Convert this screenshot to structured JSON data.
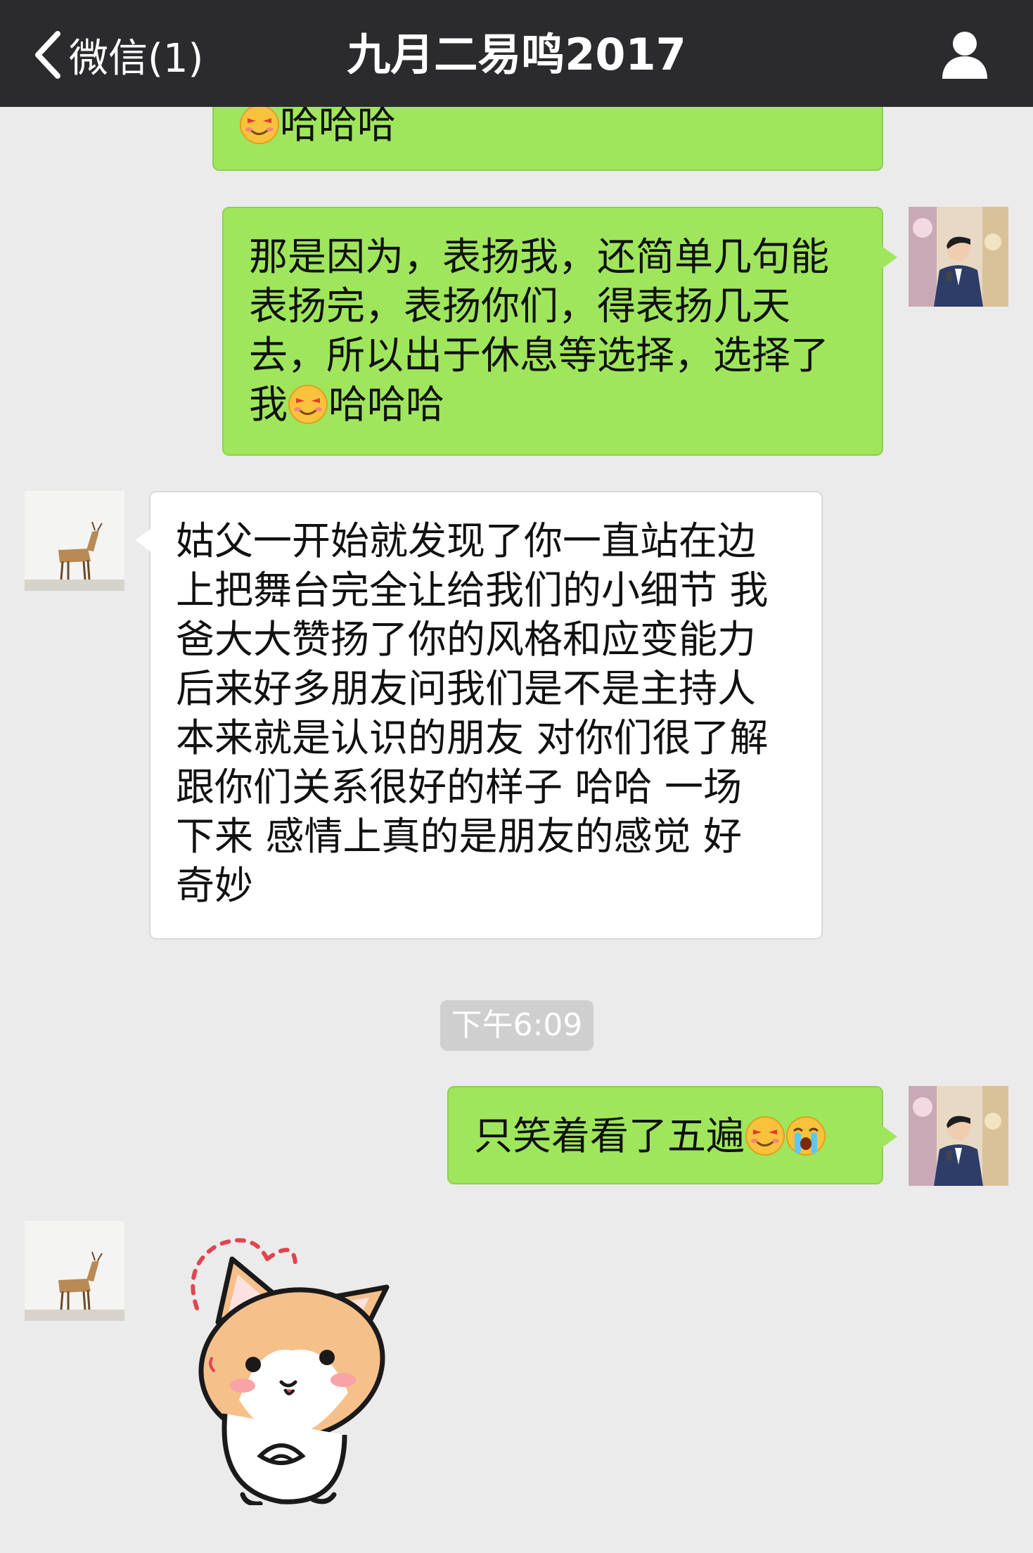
{
  "header": {
    "back_label": "微信(1)",
    "title": "九月二易鸣2017"
  },
  "messages": [
    {
      "from": "me",
      "parts": [
        "哈哈哈"
      ]
    },
    {
      "from": "me",
      "lines": [
        "那是因为，表扬我，还简单几句能",
        "表扬完，表扬你们，得表扬几天",
        "去，所以出于休息等选择，选择了",
        "我",
        "哈哈哈"
      ]
    },
    {
      "from": "other",
      "lines": [
        "姑父一开始就发现了你一直站在边",
        "上把舞台完全让给我们的小细节 我",
        "爸大大赞扬了你的风格和应变能力",
        "后来好多朋友问我们是不是主持人",
        "本来就是认识的朋友 对你们很了解",
        "跟你们关系很好的样子 哈哈 一场",
        "下来 感情上真的是朋友的感觉 好",
        "奇妙"
      ]
    },
    {
      "from": "me",
      "text": "只笑着看了五遍"
    }
  ],
  "timestamp": "下午6:09",
  "emojis": {
    "smirk": "smirk-emoji",
    "cry": "crying-emoji"
  },
  "icons": {
    "back": "chevron-left-icon",
    "profile": "person-icon"
  },
  "colors": {
    "topbar": "#2b2b2d",
    "my_bubble": "#9fe65c",
    "their_bubble": "#ffffff",
    "background": "#ebebeb"
  }
}
